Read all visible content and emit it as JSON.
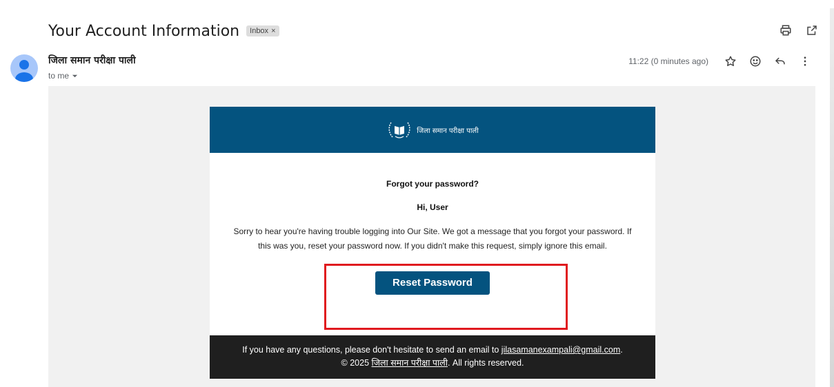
{
  "email": {
    "subject": "Your Account Information",
    "label": "Inbox",
    "label_close": "×",
    "sender_name": "जिला समान परीक्षा पाली",
    "recipient": "to me",
    "timestamp": "11:22 (0 minutes ago)"
  },
  "card": {
    "brand_name": "जिला समान परीक्षा पाली",
    "title": "Forgot your password?",
    "greeting": "Hi, User",
    "message": "Sorry to hear you're having trouble logging into Our Site. We got a message that you forgot your password. If this was you, reset your password now. If you didn't make this request, simply ignore this email.",
    "button_label": "Reset Password",
    "footer_prefix": "If you have any questions, please don't hesitate to send an email to ",
    "footer_email": "jilasamanexampali@gmail.com",
    "footer_period": ".",
    "copyright_prefix": "© 2025 ",
    "copyright_link": "जिला समान परीक्षा पाली",
    "copyright_suffix": ". All rights reserved."
  },
  "icons": {
    "print": "print-icon",
    "open_new": "open-in-new-window-icon",
    "star": "star-icon",
    "emoji": "emoji-icon",
    "reply": "reply-icon",
    "more": "more-vert-icon",
    "dropdown": "chevron-down-icon"
  },
  "colors": {
    "brand_blue": "#04537f",
    "footer_bg": "#1f1f1f",
    "highlight": "#e0191e",
    "avatar": "#a8c7fa"
  }
}
